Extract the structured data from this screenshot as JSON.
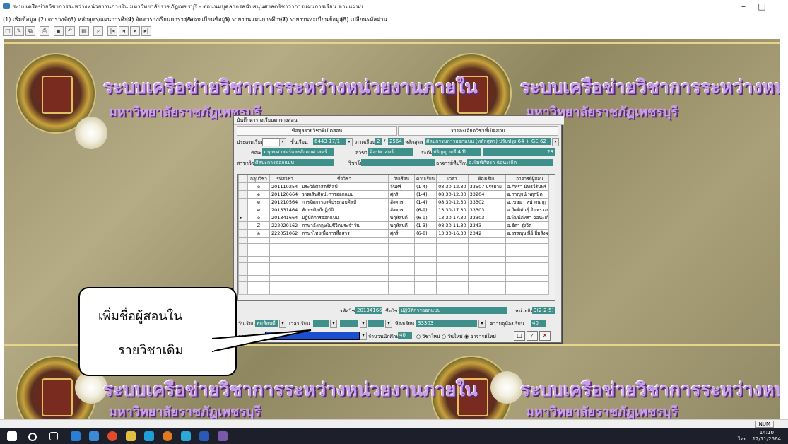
{
  "window": {
    "title": "ระบบเครือข่ายวิชาการระหว่างหน่วยงานภายใน มหาวิทยาลัยราชภัฏเพชรบุรี - ตอนนมบุคลากรสนับสนุนศาสตร์ชาวาการแผนการเรียน ตามแผนฯ",
    "minimize": "–",
    "maximize": "□"
  },
  "menu": [
    "(1) เพิ่มข้อมูล",
    "(2) ตารางจัด",
    "(3) หลักสูตร/แผนการศึกษา",
    "(4) จัดตารางเรียนตารางสอน",
    "(5) ทะเบียนข้อมูล",
    "(6) รายงานแผนการศึกษา",
    "(7) รายงานทะเบียนข้อมูล",
    "(8) เปลี่ยนรหัสผ่าน"
  ],
  "banner": {
    "title": "ระบบเครือข่ายวิชาการระหว่างหน่วยงานภายใน",
    "subtitle": "มหาวิทยาลัยราชภัฏเพชรบุรี"
  },
  "dialog": {
    "title": "บันทึกตารางเรียนตารางสอน",
    "tab_left": "ข้อมูลรายวิชาที่เปิดสอน",
    "tab_right": "รายละเอียดวิชาที่เปิดสอน",
    "labels": {
      "type": "ประเภทเรียน",
      "class": "ชั้นเรียน",
      "term": "ภาคเรียน",
      "curriculum": "หลักสูตร",
      "faculty": "คณะ",
      "major": "สาขา",
      "degree": "ระดับ",
      "field": "สาขาวิชา",
      "subject_group": "วิชาโท",
      "advisor": "อาจารย์ที่ปรึกษา"
    },
    "values": {
      "class": "6443-17/1",
      "term": "2",
      "year": "2564",
      "curriculum": "ศิลปกรรมการออกแบบ (หลักสูตร) ปรับปรุง 64 + GE 62",
      "faculty": "มนุษยศาสตร์และสังคมศาสตร์",
      "major": "ศิลปศาสตร์",
      "degree": "ปริญญาตรี 4 ปี",
      "count": "23",
      "field": "ศิลปะการออกแบบ",
      "advisor": "อ.พิมพ์ภัทรา ฉ่อนะเกิด"
    },
    "table_headers": [
      "กลุ่มวิชา",
      "รหัสวิชา",
      "ชื่อวิชา",
      "วันเรียน",
      "คาบเรียน",
      "เวลา",
      "ห้องเรียน",
      "อาจารย์ผู้สอน"
    ],
    "rows": [
      [
        "e",
        "201110254",
        "ประวัติศาสตร์ศิลป์",
        "จันทร์",
        "(1-4)",
        "08.30-12.30",
        "33507 บรรยาย",
        "อ.ภัทรา มัทธวีรินทร์"
      ],
      [
        "e",
        "201120664",
        "วาดเส้นศิลปะการออกแบบ",
        "ศุกร์",
        "(1-4)",
        "08.30-12.30",
        "33204",
        "อ.กาญจน์ พฤกษิต"
      ],
      [
        "e",
        "201210564",
        "การจัดการองค์ประกอบศิลป์",
        "อังคาร",
        "(1-4)",
        "08.30-12.30",
        "33302",
        "อ.เขษมา หน่วงนาฏา"
      ],
      [
        "e",
        "201331464",
        "ทักษะศิลป์ปฏิบัติ",
        "อังคาร",
        "(6-9)",
        "13.30-17.30",
        "33303",
        "อ.กิตติพันธุ์ อินทรวงษ์"
      ],
      [
        "e",
        "201341664",
        "ปฏิบัติการออกแบบ",
        "พฤหัสบดี",
        "(6-9)",
        "13.30-17.30",
        "33303",
        "อ.พิมพ์ภัทรา ฉ่อนะเกิด"
      ],
      [
        "Z",
        "222020162",
        "ภาษาอังกฤษในชีวิตประจำวัน",
        "พฤหัสบดี",
        "(1-3)",
        "08.30-11.30",
        "2343",
        "อ.ธิดา รุ่งจิต"
      ],
      [
        "a",
        "222051062",
        "ภาษาไทยเพื่อการสื่อสาร",
        "ศุกร์",
        "(6-8)",
        "13.30-16.30",
        "2342",
        "อ.วรรณุษณีย์ ยิ้มสั่งผล"
      ]
    ],
    "bottom": {
      "code_label": "รหัสวิชา",
      "code_value": "201341664",
      "name_label": "ชื่อวิชา",
      "name_value": "ปฏิบัติการออกแบบ",
      "credit_label": "หน่วยกิต",
      "credit_value": "3(2-2-5)",
      "day_label": "วันเรียน",
      "day_value": "พฤหัสบดี",
      "period_label": "เวลาเรียน",
      "room_label": "ห้องเรียน",
      "room_value": "33303",
      "capacity_label": "ความจุห้องเรียน",
      "capacity_value": "40",
      "teacher_label": "อาจารย์ผู้สอน",
      "students_label": "จำนวนนักศึกษา",
      "students_value": "40",
      "radio_new_subject": "วิชาใหม่",
      "radio_new_day": "วันใหม่",
      "radio_new_teacher": "อาจารย์ใหม่"
    }
  },
  "callout": {
    "line1": "เพิ่มชื่อผู้สอนใน",
    "line2": "รายวิชาเดิม"
  },
  "status": {
    "num": "NUM"
  },
  "taskbar": {
    "lang": "ไทย",
    "time": "14:10",
    "date": "12/11/2564"
  },
  "colors": {
    "field_teal": "#3f8f8a",
    "selection_blue": "#1a4fd0",
    "banner_text": "#c8a0e8"
  }
}
